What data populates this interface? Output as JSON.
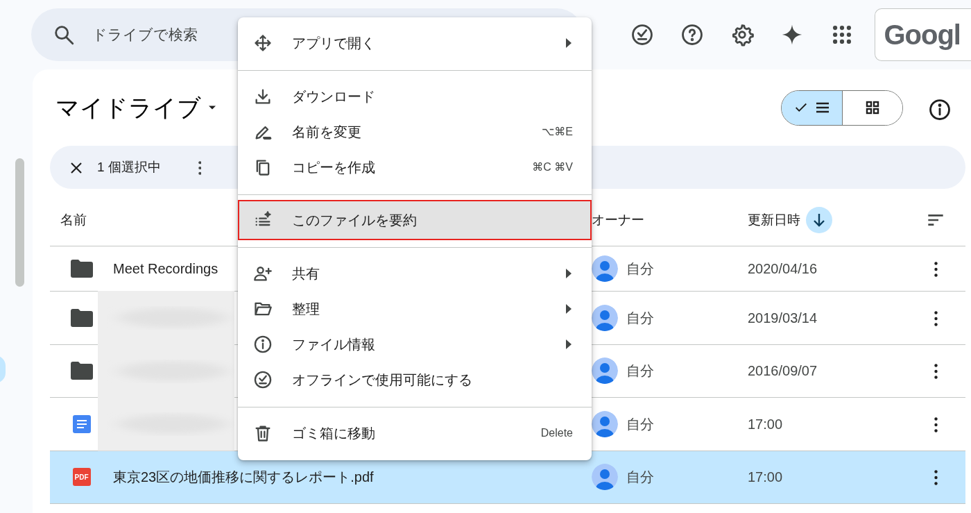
{
  "search": {
    "placeholder": "ドライブで検索"
  },
  "account": {
    "logo_text": "Googl"
  },
  "title": "マイドライブ",
  "view_toggle": [
    {
      "kind": "list",
      "selected": true
    },
    {
      "kind": "grid",
      "selected": false
    }
  ],
  "selection_bar": {
    "count": "1 個選択中"
  },
  "table": {
    "columns": [
      "名前",
      "オーナー",
      "更新日時"
    ],
    "rows": [
      {
        "kind": "folder",
        "name": "Meet Recordings",
        "blurred": false,
        "owner": "自分",
        "modified": "2020/04/16",
        "selected": false
      },
      {
        "kind": "folder",
        "blurred": true,
        "owner": "自分",
        "modified": "2019/03/14",
        "selected": false
      },
      {
        "kind": "folder",
        "blurred": true,
        "owner": "自分",
        "modified": "2016/09/07",
        "selected": false
      },
      {
        "kind": "doc",
        "blurred": true,
        "owner": "自分",
        "modified": "17:00",
        "selected": false
      },
      {
        "kind": "pdf",
        "badge": "PDF",
        "name": "東京23区の地価推移に関するレポート.pdf",
        "blurred": false,
        "owner": "自分",
        "modified": "17:00",
        "selected": true
      }
    ]
  },
  "context_menu": {
    "groups": [
      [
        {
          "kind": "open",
          "label": "アプリで開く",
          "submenu": true,
          "highlighted": false
        }
      ],
      [
        {
          "kind": "download",
          "label": "ダウンロード",
          "submenu": false,
          "highlighted": false
        },
        {
          "kind": "rename",
          "label": "名前を変更",
          "shortcut": "⌥⌘E",
          "submenu": false,
          "highlighted": false
        },
        {
          "kind": "copy",
          "label": "コピーを作成",
          "shortcut": "⌘C ⌘V",
          "submenu": false,
          "highlighted": false
        }
      ],
      [
        {
          "kind": "summarize",
          "label": "このファイルを要約",
          "submenu": false,
          "highlighted": true
        }
      ],
      [
        {
          "kind": "share",
          "label": "共有",
          "submenu": true,
          "highlighted": false
        },
        {
          "kind": "organize",
          "label": "整理",
          "submenu": true,
          "highlighted": false
        },
        {
          "kind": "info",
          "label": "ファイル情報",
          "submenu": true,
          "highlighted": false
        },
        {
          "kind": "offline",
          "label": "オフラインで使用可能にする",
          "submenu": false,
          "highlighted": false
        }
      ],
      [
        {
          "kind": "trash",
          "label": "ゴミ箱に移動",
          "shortcut": "Delete",
          "submenu": false,
          "highlighted": false
        }
      ]
    ]
  }
}
